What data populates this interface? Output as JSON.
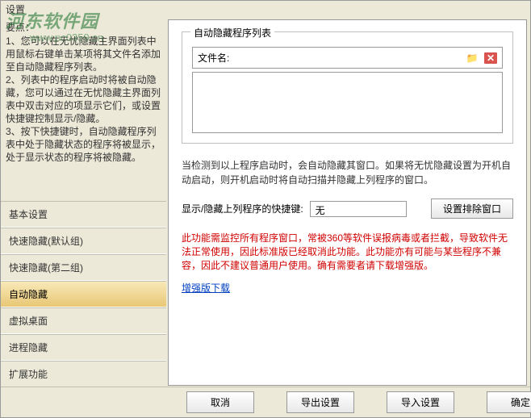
{
  "window": {
    "title": "设置"
  },
  "watermark": {
    "text": "河东软件园",
    "url": "www.pc0359.cn"
  },
  "tips": {
    "heading": "要点：",
    "body": "1、您可以在无忧隐藏主界面列表中用鼠标右键单击某项将其文件名添加至自动隐藏程序列表。\n2、列表中的程序启动时将被自动隐藏，您可以通过在无忧隐藏主界面列表中双击对应的项显示它们，或设置快捷键控制显示/隐藏。\n3、按下快捷键时，自动隐藏程序列表中处于隐藏状态的程序将被显示，处于显示状态的程序将被隐藏。"
  },
  "nav": {
    "items": [
      {
        "label": "基本设置"
      },
      {
        "label": "快速隐藏(默认组)"
      },
      {
        "label": "快速隐藏(第二组)"
      },
      {
        "label": "自动隐藏"
      },
      {
        "label": "虚拟桌面"
      },
      {
        "label": "进程隐藏"
      },
      {
        "label": "扩展功能"
      }
    ],
    "activeIndex": 3
  },
  "panel": {
    "groupTitle": "自动隐藏程序列表",
    "fileLabel": "文件名:",
    "descText": "当检测到以上程序启动时，会自动隐藏其窗口。如果将无忧隐藏设置为开机自动启动，则开机启动时将自动扫描并隐藏上列程序的窗口。",
    "shortcutLabel": "显示/隐藏上列程序的快捷键:",
    "shortcutValue": "无",
    "excludeBtn": "设置排除窗口",
    "warning": "此功能需监控所有程序窗口，常被360等软件误报病毒或者拦截，导致软件无法正常使用，因此标准版已经取消此功能。此功能亦有可能与某些程序不兼容，因此不建议普通用户使用。确有需要者请下载增强版。",
    "enhancedLink": "增强版下载"
  },
  "buttons": {
    "cancel": "取消",
    "export": "导出设置",
    "import": "导入设置",
    "ok": "确定"
  }
}
